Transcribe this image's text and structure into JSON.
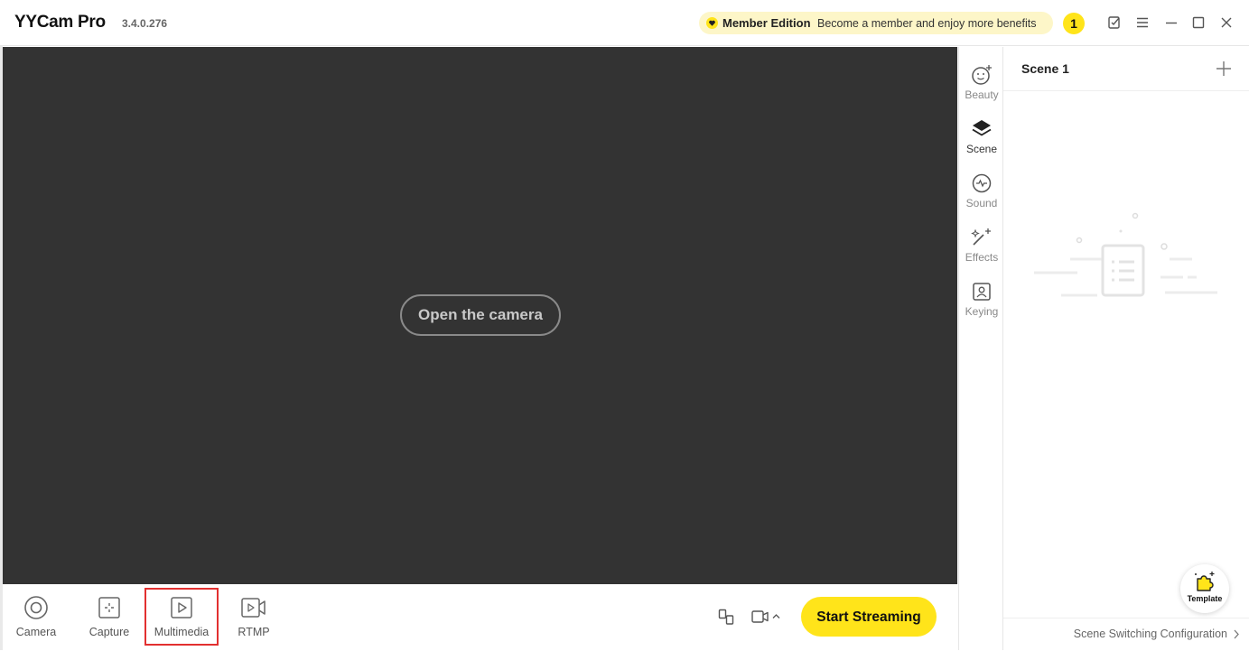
{
  "app": {
    "title": "YYCam Pro",
    "version": "3.4.0.276"
  },
  "member": {
    "title": "Member Edition",
    "subtitle": "Become a member and enjoy more benefits",
    "notification_count": "1"
  },
  "preview": {
    "open_camera_label": "Open the camera",
    "background": "#333333"
  },
  "sources": [
    {
      "label": "Camera",
      "icon": "camera-icon"
    },
    {
      "label": "Capture",
      "icon": "capture-icon"
    },
    {
      "label": "Multimedia",
      "icon": "multimedia-icon"
    },
    {
      "label": "RTMP",
      "icon": "rtmp-icon"
    }
  ],
  "streaming": {
    "start_label": "Start Streaming"
  },
  "tools": [
    {
      "label": "Beauty",
      "icon": "beauty-icon"
    },
    {
      "label": "Scene",
      "icon": "scene-layers-icon"
    },
    {
      "label": "Sound",
      "icon": "sound-icon"
    },
    {
      "label": "Effects",
      "icon": "effects-icon"
    },
    {
      "label": "Keying",
      "icon": "keying-icon"
    }
  ],
  "scene": {
    "title": "Scene 1",
    "template_label": "Template",
    "switch_config_label": "Scene Switching Configuration"
  },
  "colors": {
    "accent": "#ffe41a",
    "member_bg": "#fdf6c8",
    "highlight": "#e23030"
  }
}
